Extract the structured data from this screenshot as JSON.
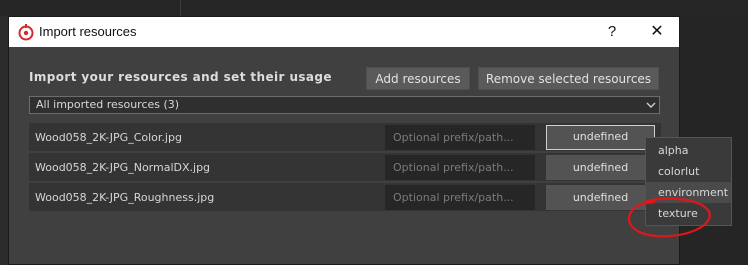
{
  "dialog": {
    "title": "Import resources",
    "help_label": "?",
    "close_label": "✕"
  },
  "header": {
    "heading": "Import your resources and set their usage",
    "add_label": "Add resources",
    "remove_label": "Remove selected resources"
  },
  "filter": {
    "selected": "All imported resources (3)"
  },
  "resources": [
    {
      "name": "Wood058_2K-JPG_Color.jpg",
      "prefix_placeholder": "Optional prefix/path...",
      "usage": "undefined"
    },
    {
      "name": "Wood058_2K-JPG_NormalDX.jpg",
      "prefix_placeholder": "Optional prefix/path...",
      "usage": "undefined"
    },
    {
      "name": "Wood058_2K-JPG_Roughness.jpg",
      "prefix_placeholder": "Optional prefix/path...",
      "usage": "undefined"
    }
  ],
  "usage_menu": {
    "options": [
      "alpha",
      "colorlut",
      "environment",
      "texture"
    ],
    "highlighted": "environment"
  },
  "colors": {
    "dialog_bg": "#404040",
    "row_bg": "#343434",
    "input_bg": "#262626",
    "button_bg": "#5a5a5a",
    "annotation_red": "#e0161b"
  }
}
